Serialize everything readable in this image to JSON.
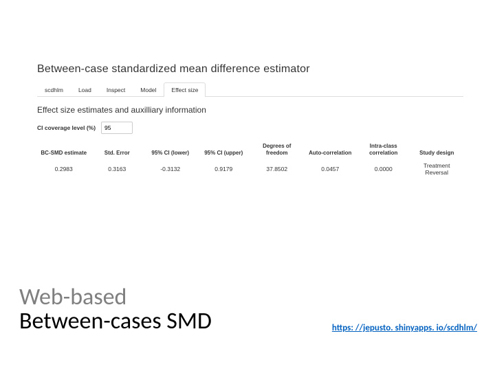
{
  "app": {
    "title": "Between-case standardized mean difference estimator",
    "tabs": [
      "scdhlm",
      "Load",
      "Inspect",
      "Model",
      "Effect size"
    ],
    "active_tab_index": 4,
    "section_title": "Effect size estimates and auxilliary information",
    "ci": {
      "label": "CI coverage level (%)",
      "value": "95"
    },
    "table": {
      "headers": [
        "BC-SMD estimate",
        "Std. Error",
        "95% CI (lower)",
        "95% CI (upper)",
        "Degrees of freedom",
        "Auto-correlation",
        "Intra-class correlation",
        "Study design"
      ],
      "row": [
        "0.2983",
        "0.3163",
        "-0.3132",
        "0.9179",
        "37.8502",
        "0.0457",
        "0.0000",
        "Treatment Reversal"
      ]
    }
  },
  "footer": {
    "line1": "Web-based",
    "line2": "Between-cases SMD",
    "url": "https: //jepusto. shinyapps. io/scdhlm/"
  }
}
